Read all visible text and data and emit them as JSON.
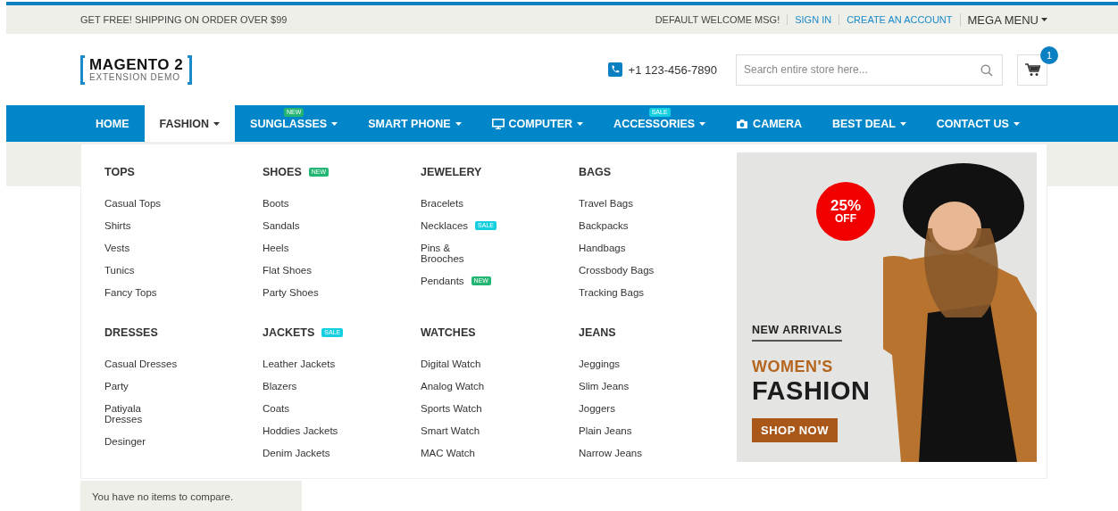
{
  "top_bar": {
    "promo": "GET FREE! SHIPPING ON ORDER OVER $99",
    "welcome": "DEFAULT WELCOME MSG!",
    "links": [
      "SIGN IN",
      "CREATE AN ACCOUNT"
    ],
    "mega_menu": "MEGA MENU"
  },
  "header": {
    "logo_title": "MAGENTO 2",
    "logo_subtitle": "EXTENSION DEMO",
    "phone": "+1 123-456-7890",
    "search": {
      "placeholder": "Search entire store here..."
    },
    "cart_count": "1"
  },
  "nav": [
    {
      "kind": "text",
      "label": "HOME",
      "selected": false,
      "caret": false
    },
    {
      "kind": "text",
      "label": "FASHION",
      "selected": true,
      "caret": true
    },
    {
      "kind": "text",
      "label": "SUNGLASSES",
      "selected": false,
      "caret": true,
      "badge": {
        "text": "NEW",
        "kind": "new"
      }
    },
    {
      "kind": "text",
      "label": "SMART PHONE",
      "selected": false,
      "caret": true
    },
    {
      "kind": "monitor",
      "label": "COMPUTER",
      "selected": false,
      "caret": true
    },
    {
      "kind": "text",
      "label": "ACCESSORIES",
      "selected": false,
      "caret": true,
      "badge": {
        "text": "SALE",
        "kind": "sale"
      }
    },
    {
      "kind": "camera",
      "label": "CAMERA",
      "selected": false,
      "caret": false
    },
    {
      "kind": "text",
      "label": "BEST DEAL",
      "selected": false,
      "caret": true
    },
    {
      "kind": "text",
      "label": "CONTACT US",
      "selected": false,
      "caret": true
    }
  ],
  "mega_menu": {
    "groups": [
      {
        "heading": "TOPS",
        "items": [
          {
            "label": "Casual Tops"
          },
          {
            "label": "Shirts"
          },
          {
            "label": "Vests"
          },
          {
            "label": "Tunics"
          },
          {
            "label": "Fancy Tops"
          }
        ]
      },
      {
        "heading": "SHOES",
        "badge": {
          "text": "NEW",
          "kind": "new"
        },
        "items": [
          {
            "label": "Boots"
          },
          {
            "label": "Sandals"
          },
          {
            "label": "Heels"
          },
          {
            "label": "Flat Shoes"
          },
          {
            "label": "Party Shoes"
          }
        ]
      },
      {
        "heading": "JEWELERY",
        "items": [
          {
            "label": "Bracelets"
          },
          {
            "label": "Necklaces",
            "badge": {
              "text": "SALE",
              "kind": "sale"
            }
          },
          {
            "label": "Pins &\nBrooches"
          },
          {
            "label": "Pendants",
            "badge": {
              "text": "NEW",
              "kind": "new"
            }
          }
        ]
      },
      {
        "heading": "BAGS",
        "items": [
          {
            "label": "Travel Bags"
          },
          {
            "label": "Backpacks"
          },
          {
            "label": "Handbags"
          },
          {
            "label": "Crossbody Bags"
          },
          {
            "label": "Tracking Bags"
          }
        ]
      },
      {
        "heading": "DRESSES",
        "items": [
          {
            "label": "Casual Dresses"
          },
          {
            "label": "Party"
          },
          {
            "label": "Patiyala\nDresses"
          },
          {
            "label": "Desinger"
          }
        ]
      },
      {
        "heading": "JACKETS",
        "badge": {
          "text": "SALE",
          "kind": "sale"
        },
        "items": [
          {
            "label": "Leather Jackets"
          },
          {
            "label": "Blazers"
          },
          {
            "label": "Coats"
          },
          {
            "label": "Hoddies Jackets"
          },
          {
            "label": "Denim Jackets"
          }
        ]
      },
      {
        "heading": "WATCHES",
        "items": [
          {
            "label": "Digital Watch"
          },
          {
            "label": "Analog Watch"
          },
          {
            "label": "Sports Watch"
          },
          {
            "label": "Smart Watch"
          },
          {
            "label": "MAC Watch"
          }
        ]
      },
      {
        "heading": "JEANS",
        "items": [
          {
            "label": "Jeggings"
          },
          {
            "label": "Slim Jeans"
          },
          {
            "label": "Joggers"
          },
          {
            "label": "Plain Jeans"
          },
          {
            "label": "Narrow Jeans"
          }
        ]
      }
    ],
    "banner": {
      "discount": "25%",
      "discount_sub": "OFF",
      "eyebrow": "NEW ARRIVALS",
      "subtitle": "WOMEN'S",
      "title": "FASHION",
      "button": "SHOP NOW"
    }
  },
  "compare": "You have no items to compare."
}
